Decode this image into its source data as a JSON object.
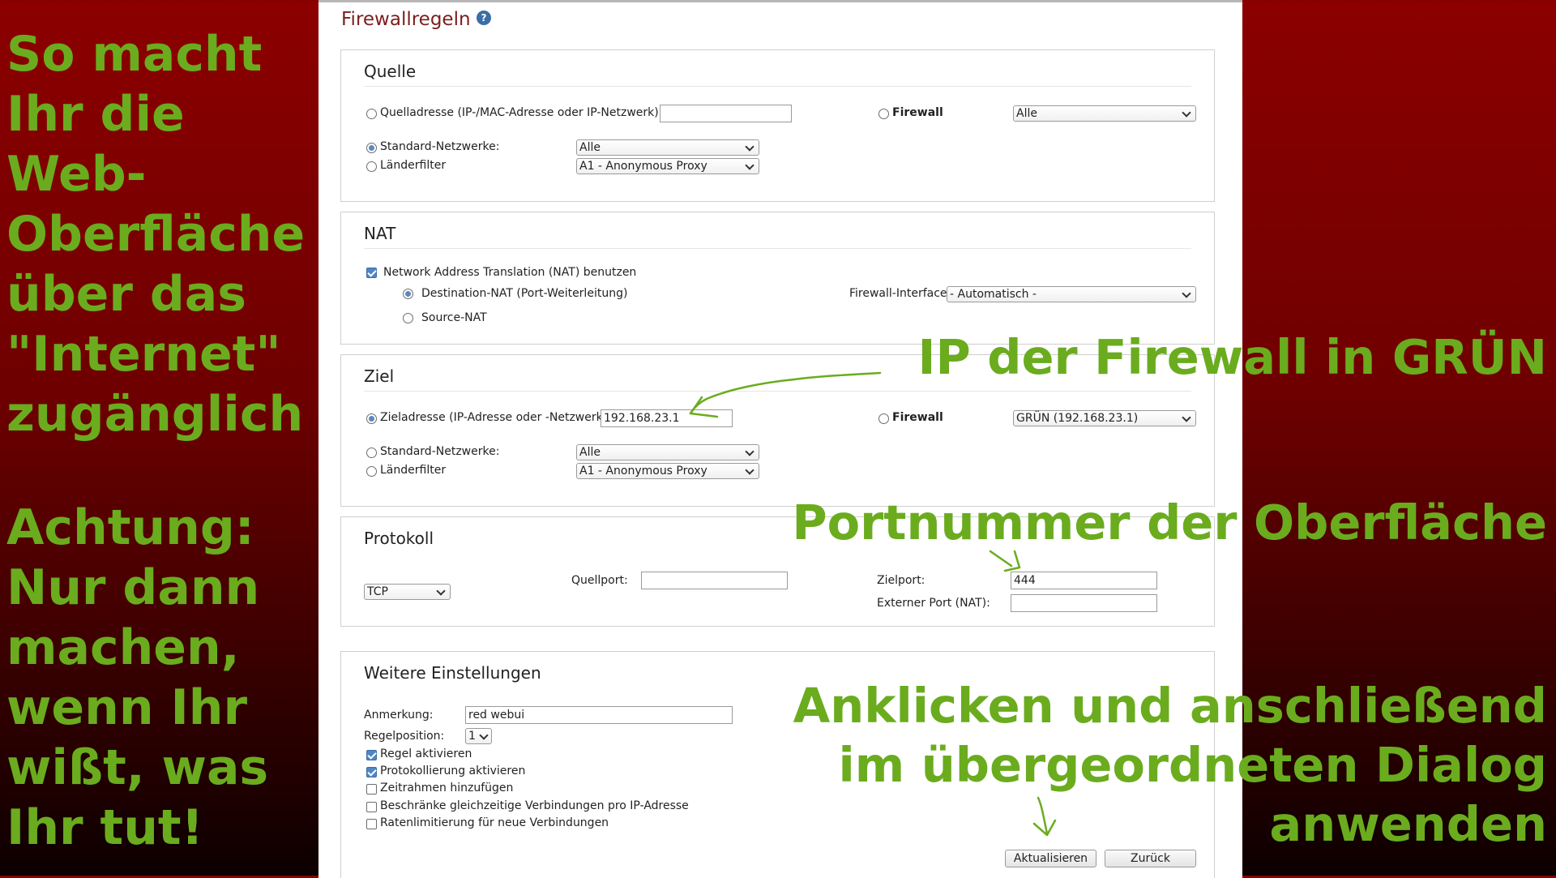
{
  "page": {
    "title": "Firewallregeln",
    "help_icon": "help-icon"
  },
  "quelle": {
    "title": "Quelle",
    "source_address_label": "Quelladresse (IP-/MAC-Adresse oder IP-Netzwerk):",
    "source_address_value": "",
    "firewall_label": "Firewall",
    "firewall_select": "Alle",
    "standard_networks_label": "Standard-Netzwerke:",
    "standard_networks_select": "Alle",
    "country_filter_label": "Länderfilter",
    "country_filter_select": "A1 - Anonymous Proxy"
  },
  "nat": {
    "title": "NAT",
    "use_nat_label": "Network Address Translation (NAT) benutzen",
    "dnat_label": "Destination-NAT (Port-Weiterleitung)",
    "snat_label": "Source-NAT",
    "fw_interface_label": "Firewall-Interface:",
    "fw_interface_select": "- Automatisch -"
  },
  "ziel": {
    "title": "Ziel",
    "dest_address_label": "Zieladresse (IP-Adresse oder -Netzwerk):",
    "dest_address_value": "192.168.23.1",
    "firewall_label": "Firewall",
    "firewall_select": "GRÜN (192.168.23.1)",
    "standard_networks_label": "Standard-Netzwerke:",
    "standard_networks_select": "Alle",
    "country_filter_label": "Länderfilter",
    "country_filter_select": "A1 - Anonymous Proxy"
  },
  "protokoll": {
    "title": "Protokoll",
    "protocol_select": "TCP",
    "source_port_label": "Quellport:",
    "source_port_value": "",
    "dest_port_label": "Zielport:",
    "dest_port_value": "444",
    "external_port_label": "Externer Port (NAT):",
    "external_port_value": ""
  },
  "weitere": {
    "title": "Weitere Einstellungen",
    "remark_label": "Anmerkung:",
    "remark_value": "red webui",
    "rule_position_label": "Regelposition:",
    "rule_position_select": "1",
    "options": [
      {
        "label": "Regel aktivieren",
        "checked": true
      },
      {
        "label": "Protokollierung aktivieren",
        "checked": true
      },
      {
        "label": "Zeitrahmen hinzufügen",
        "checked": false
      },
      {
        "label": "Beschränke gleichzeitige Verbindungen pro IP-Adresse",
        "checked": false
      },
      {
        "label": "Ratenlimitierung für neue Verbindungen",
        "checked": false
      }
    ],
    "update_button": "Aktualisieren",
    "back_button": "Zurück"
  },
  "annotations": {
    "left_top": [
      "So macht",
      "Ihr die",
      "Web-",
      "Oberfläche",
      "über das",
      "\"Internet\"",
      "zugänglich"
    ],
    "left_bottom": [
      "Achtung:",
      "Nur dann",
      "machen,",
      "wenn Ihr",
      "wißt, was",
      "Ihr tut!"
    ],
    "ip_note": "IP der Firewall in GRÜN",
    "port_note": "Portnummer der Oberfläche",
    "click_note": [
      "Anklicken und anschließend",
      "im übergeordneten Dialog",
      "anwenden"
    ],
    "color": "#6aac1e"
  }
}
